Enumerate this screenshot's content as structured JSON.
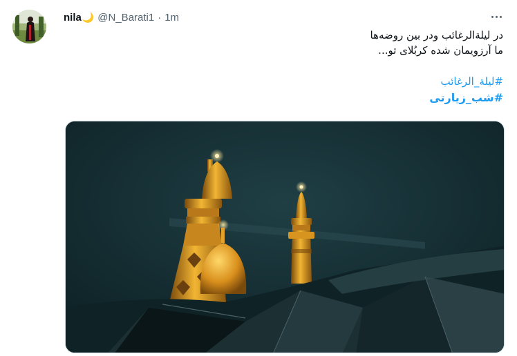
{
  "tweet": {
    "author": {
      "display_name": "nila",
      "emoji": "🌙",
      "handle": "@N_Barati1",
      "separator": "·",
      "time": "1m"
    },
    "more_icon": "more-horizontal-icon",
    "text": {
      "line1": "در لیلة‌الرغائب ودر بین روضه‌ها",
      "line2": "ما آرزویمان شده کربُلای تو..."
    },
    "hashtags": [
      "#لیلة_الرغائب",
      "#شب_زیارتی"
    ],
    "colors": {
      "link": "#1d9bf0",
      "secondary_text": "#536471",
      "primary_text": "#0f1419"
    }
  }
}
